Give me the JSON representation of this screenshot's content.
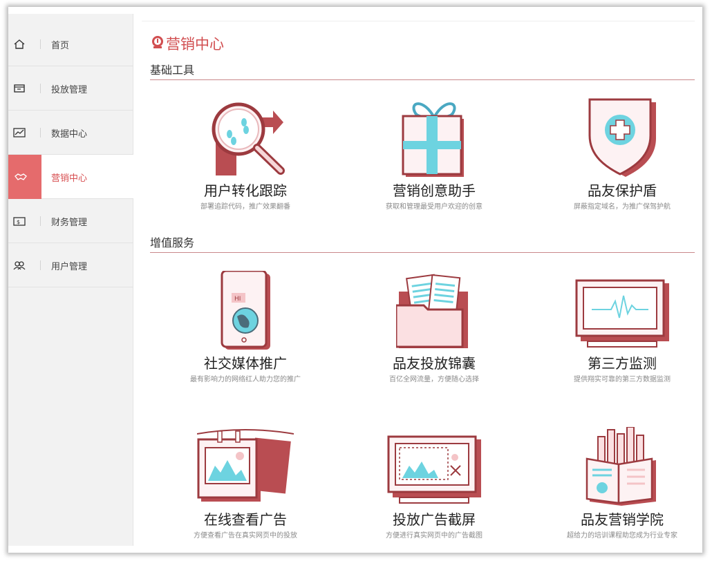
{
  "sidebar": {
    "items": [
      {
        "label": "首页",
        "icon": "home-icon"
      },
      {
        "label": "投放管理",
        "icon": "ad-placement-icon"
      },
      {
        "label": "数据中心",
        "icon": "chart-icon"
      },
      {
        "label": "营销中心",
        "icon": "handshake-icon",
        "active": true
      },
      {
        "label": "财务管理",
        "icon": "wallet-icon"
      },
      {
        "label": "用户管理",
        "icon": "users-icon"
      }
    ]
  },
  "header": {
    "title": "营销中心",
    "icon": "badge-icon"
  },
  "sections": [
    {
      "heading": "基础工具",
      "cards": [
        {
          "title": "用户转化跟踪",
          "desc": "部署追踪代码，推广效果翻番",
          "icon": "magnifier-footprints-icon"
        },
        {
          "title": "营销创意助手",
          "desc": "获取和管理最受用户欢迎的创意",
          "icon": "gift-box-icon"
        },
        {
          "title": "品友保护盾",
          "desc": "屏蔽指定域名，为推广保驾护航",
          "icon": "shield-icon"
        }
      ]
    },
    {
      "heading": "增值服务",
      "cards": [
        {
          "title": "社交媒体推广",
          "desc": "最有影响力的网络红人助力您的推广",
          "icon": "phone-globe-icon"
        },
        {
          "title": "品友投放锦囊",
          "desc": "百亿全网流量，方便随心选择",
          "icon": "folder-icon"
        },
        {
          "title": "第三方监测",
          "desc": "提供翔实可靠的第三方数据监测",
          "icon": "monitor-icon"
        },
        {
          "title": "在线查看广告",
          "desc": "方便查看广告在真实网页中的投放",
          "icon": "hanging-photos-icon"
        },
        {
          "title": "投放广告截屏",
          "desc": "方便进行真实网页中的广告截图",
          "icon": "screenshot-icon"
        },
        {
          "title": "品友营销学院",
          "desc": "超给力的培训课程助您成为行业专家",
          "icon": "book-icon"
        }
      ]
    }
  ],
  "colors": {
    "accent": "#e56b6c",
    "title": "#d14e50",
    "illustration_outline": "#9c3a3f",
    "illustration_cyan": "#6dd3e0"
  }
}
